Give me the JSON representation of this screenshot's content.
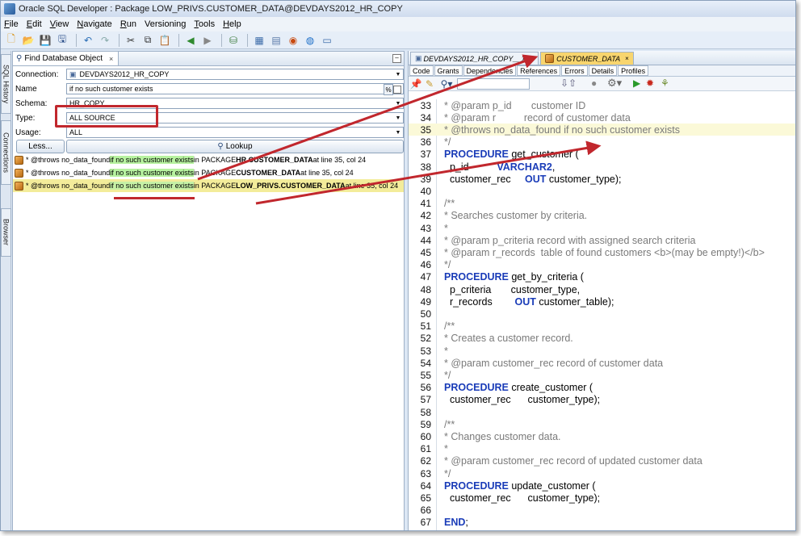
{
  "window": {
    "title": "Oracle SQL Developer : Package LOW_PRIVS.CUSTOMER_DATA@DEVDAYS2012_HR_COPY"
  },
  "menu": [
    {
      "label": "File",
      "u": "F",
      "rest": "ile"
    },
    {
      "label": "Edit",
      "u": "E",
      "rest": "dit"
    },
    {
      "label": "View",
      "u": "V",
      "rest": "iew"
    },
    {
      "label": "Navigate",
      "u": "N",
      "rest": "avigate"
    },
    {
      "label": "Run",
      "u": "R",
      "rest": "un"
    },
    {
      "label": "Versioning",
      "u": "",
      "rest": "Versioning"
    },
    {
      "label": "Tools",
      "u": "T",
      "rest": "ools"
    },
    {
      "label": "Help",
      "u": "H",
      "rest": "elp"
    }
  ],
  "side_tabs": [
    "SQL History",
    "Connections",
    "Browser"
  ],
  "find_panel": {
    "tab_label": "Find Database Object",
    "tab_close": "×",
    "minimize": "–",
    "connection_label": "Connection:",
    "connection_value": "DEVDAYS2012_HR_COPY",
    "name_label": "Name",
    "name_value": "if no such customer exists",
    "pct": "%",
    "schema_label": "Schema:",
    "schema_value": "HR_COPY",
    "type_label": "Type:",
    "type_value": "ALL SOURCE",
    "usage_label": "Usage:",
    "usage_value": "ALL",
    "less_button": "Less...",
    "lookup_button": "Lookup",
    "results": [
      {
        "pre": "* @throws no_data_found ",
        "hl": "if no such customer exists",
        "mid": " in PACKAGE ",
        "obj": "HR.CUSTOMER_DATA",
        "post": " at line 35, col 24"
      },
      {
        "pre": "* @throws no_data_found ",
        "hl": "if no such customer exists",
        "mid": " in PACKAGE ",
        "obj": "CUSTOMER_DATA",
        "post": " at line 35, col 24"
      },
      {
        "pre": "* @throws no_data_found ",
        "hl": "if no such customer exists",
        "mid": " in PACKAGE ",
        "obj": "LOW_PRIVS.CUSTOMER_DATA",
        "post": " at line 35, col 24"
      }
    ]
  },
  "editor": {
    "tabs": [
      {
        "label": "DEVDAYS2012_HR_COPY__1",
        "close": "×"
      },
      {
        "label": "CUSTOMER_DATA",
        "close": "×"
      }
    ],
    "sub_tabs": [
      "Code",
      "Grants",
      "Dependencies",
      "References",
      "Errors",
      "Details",
      "Profiles"
    ],
    "lines": [
      {
        "n": "33",
        "t": "* @param p_id       customer ID",
        "k": "c"
      },
      {
        "n": "34",
        "t": "* @param r          record of customer data",
        "k": "c"
      },
      {
        "n": "35",
        "t": "* @throws no_data_found if no such customer exists",
        "k": "c"
      },
      {
        "n": "36",
        "t": "*/",
        "k": "c"
      },
      {
        "n": "37",
        "a": "PROCEDURE",
        "b": " get_customer (",
        "k": "p"
      },
      {
        "n": "38",
        "a": "  p_id",
        "b": "",
        "c": "          VARCHAR2",
        "d": ",",
        "k": "v"
      },
      {
        "n": "39",
        "a": "  customer_rec     ",
        "b": "OUT",
        "c": " customer_type);",
        "k": "o"
      },
      {
        "n": "40",
        "t": "",
        "k": "c"
      },
      {
        "n": "41",
        "t": "/**",
        "k": "c"
      },
      {
        "n": "42",
        "t": "* Searches customer by criteria.",
        "k": "c"
      },
      {
        "n": "43",
        "t": "*",
        "k": "c"
      },
      {
        "n": "44",
        "t": "* @param p_criteria record with assigned search criteria",
        "k": "c"
      },
      {
        "n": "45",
        "t": "* @param r_records  table of found customers <b>(may be empty!)</b>",
        "k": "c"
      },
      {
        "n": "46",
        "t": "*/",
        "k": "c"
      },
      {
        "n": "47",
        "a": "PROCEDURE",
        "b": " get_by_criteria (",
        "k": "p"
      },
      {
        "n": "48",
        "t": "  p_criteria       customer_type,",
        "k": "n"
      },
      {
        "n": "49",
        "a": "  r_records        ",
        "b": "OUT",
        "c": " customer_table);",
        "k": "o"
      },
      {
        "n": "50",
        "t": "",
        "k": "c"
      },
      {
        "n": "51",
        "t": "/**",
        "k": "c"
      },
      {
        "n": "52",
        "t": "* Creates a customer record.",
        "k": "c"
      },
      {
        "n": "53",
        "t": "*",
        "k": "c"
      },
      {
        "n": "54",
        "t": "* @param customer_rec record of customer data",
        "k": "c"
      },
      {
        "n": "55",
        "t": "*/",
        "k": "c"
      },
      {
        "n": "56",
        "a": "PROCEDURE",
        "b": " create_customer (",
        "k": "p"
      },
      {
        "n": "57",
        "t": "  customer_rec      customer_type);",
        "k": "n"
      },
      {
        "n": "58",
        "t": "",
        "k": "c"
      },
      {
        "n": "59",
        "t": "/**",
        "k": "c"
      },
      {
        "n": "60",
        "t": "* Changes customer data.",
        "k": "c"
      },
      {
        "n": "61",
        "t": "*",
        "k": "c"
      },
      {
        "n": "62",
        "t": "* @param customer_rec record of updated customer data",
        "k": "c"
      },
      {
        "n": "63",
        "t": "*/",
        "k": "c"
      },
      {
        "n": "64",
        "a": "PROCEDURE",
        "b": " update_customer (",
        "k": "p"
      },
      {
        "n": "65",
        "t": "  customer_rec      customer_type);",
        "k": "n"
      },
      {
        "n": "66",
        "t": "",
        "k": "c"
      },
      {
        "n": "67",
        "a": "END",
        "b": ";",
        "k": "p"
      }
    ]
  },
  "colors": {
    "annotation": "#c1272d",
    "highlight": "#b7f2a0",
    "selected_row": "#f3ec9a",
    "keyword": "#1a3cb8"
  }
}
